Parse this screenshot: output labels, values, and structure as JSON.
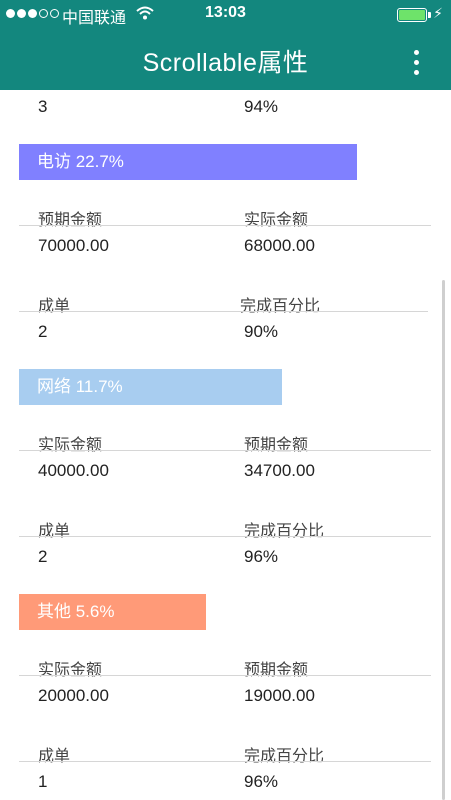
{
  "status": {
    "carrier": "中国联通",
    "time": "13:03"
  },
  "header": {
    "title": "Scrollable属性"
  },
  "top_row": {
    "left": "3",
    "right": "94%"
  },
  "sections": [
    {
      "bar_label": "电访 22.7%",
      "bar_color": "#8080ff",
      "row1": {
        "label_left": "预期金额",
        "label_right": "实际金额",
        "value_left": "70000.00",
        "value_right": "68000.00"
      },
      "row2": {
        "label_left": "成单",
        "label_right": "完成百分比",
        "value_left": "2",
        "value_right": "90%"
      }
    },
    {
      "bar_label": "网络 11.7%",
      "bar_color": "#a8cdf0",
      "row1": {
        "label_left": "实际金额",
        "label_right": "预期金额",
        "value_left": "40000.00",
        "value_right": "34700.00"
      },
      "row2": {
        "label_left": "成单",
        "label_right": "完成百分比",
        "value_left": "2",
        "value_right": "96%"
      }
    },
    {
      "bar_label": "其他 5.6%",
      "bar_color": "#ff9a78",
      "row1": {
        "label_left": "实际金额",
        "label_right": "预期金额",
        "value_left": "20000.00",
        "value_right": "19000.00"
      },
      "row2": {
        "label_left": "成单",
        "label_right": "完成百分比",
        "value_left": "1",
        "value_right": "96%"
      }
    }
  ]
}
